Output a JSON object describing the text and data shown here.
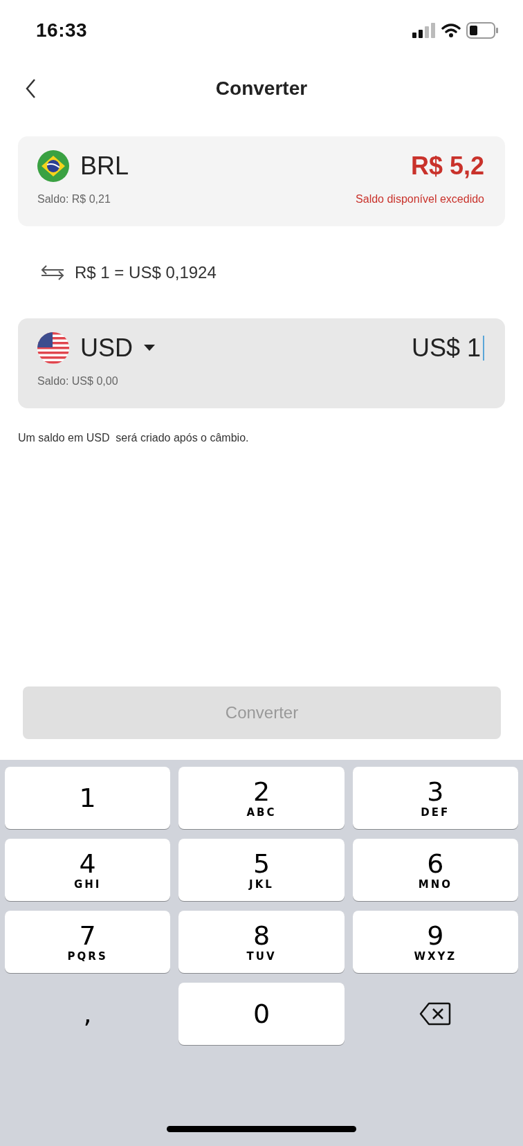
{
  "status_bar": {
    "time": "16:33"
  },
  "header": {
    "title": "Converter"
  },
  "from": {
    "currency": "BRL",
    "amount": "R$ 5,2",
    "balance": "Saldo: R$ 0,21",
    "error": "Saldo disponível excedido",
    "exceeded": true,
    "focused": false
  },
  "rate": "R$ 1 = US$ 0,1924",
  "to": {
    "currency": "USD",
    "amount": "US$ 1",
    "balance": "Saldo: US$ 0,00",
    "exceeded": false,
    "focused": true,
    "dropdown": true
  },
  "note": "Um saldo em USD  será criado após o câmbio.",
  "convert_button": {
    "label": "Converter",
    "disabled": true
  },
  "keypad": [
    {
      "kind": "digit",
      "digit": "1"
    },
    {
      "kind": "digit",
      "digit": "2",
      "letters": "ABC"
    },
    {
      "kind": "digit",
      "digit": "3",
      "letters": "DEF"
    },
    {
      "kind": "digit",
      "digit": "4",
      "letters": "GHI"
    },
    {
      "kind": "digit",
      "digit": "5",
      "letters": "JKL"
    },
    {
      "kind": "digit",
      "digit": "6",
      "letters": "MNO"
    },
    {
      "kind": "digit",
      "digit": "7",
      "letters": "PQRS"
    },
    {
      "kind": "digit",
      "digit": "8",
      "letters": "TUV"
    },
    {
      "kind": "digit",
      "digit": "9",
      "letters": "WXYZ"
    },
    {
      "kind": "plain",
      "digit": ","
    },
    {
      "kind": "digit",
      "digit": "0"
    },
    {
      "kind": "delete"
    }
  ]
}
